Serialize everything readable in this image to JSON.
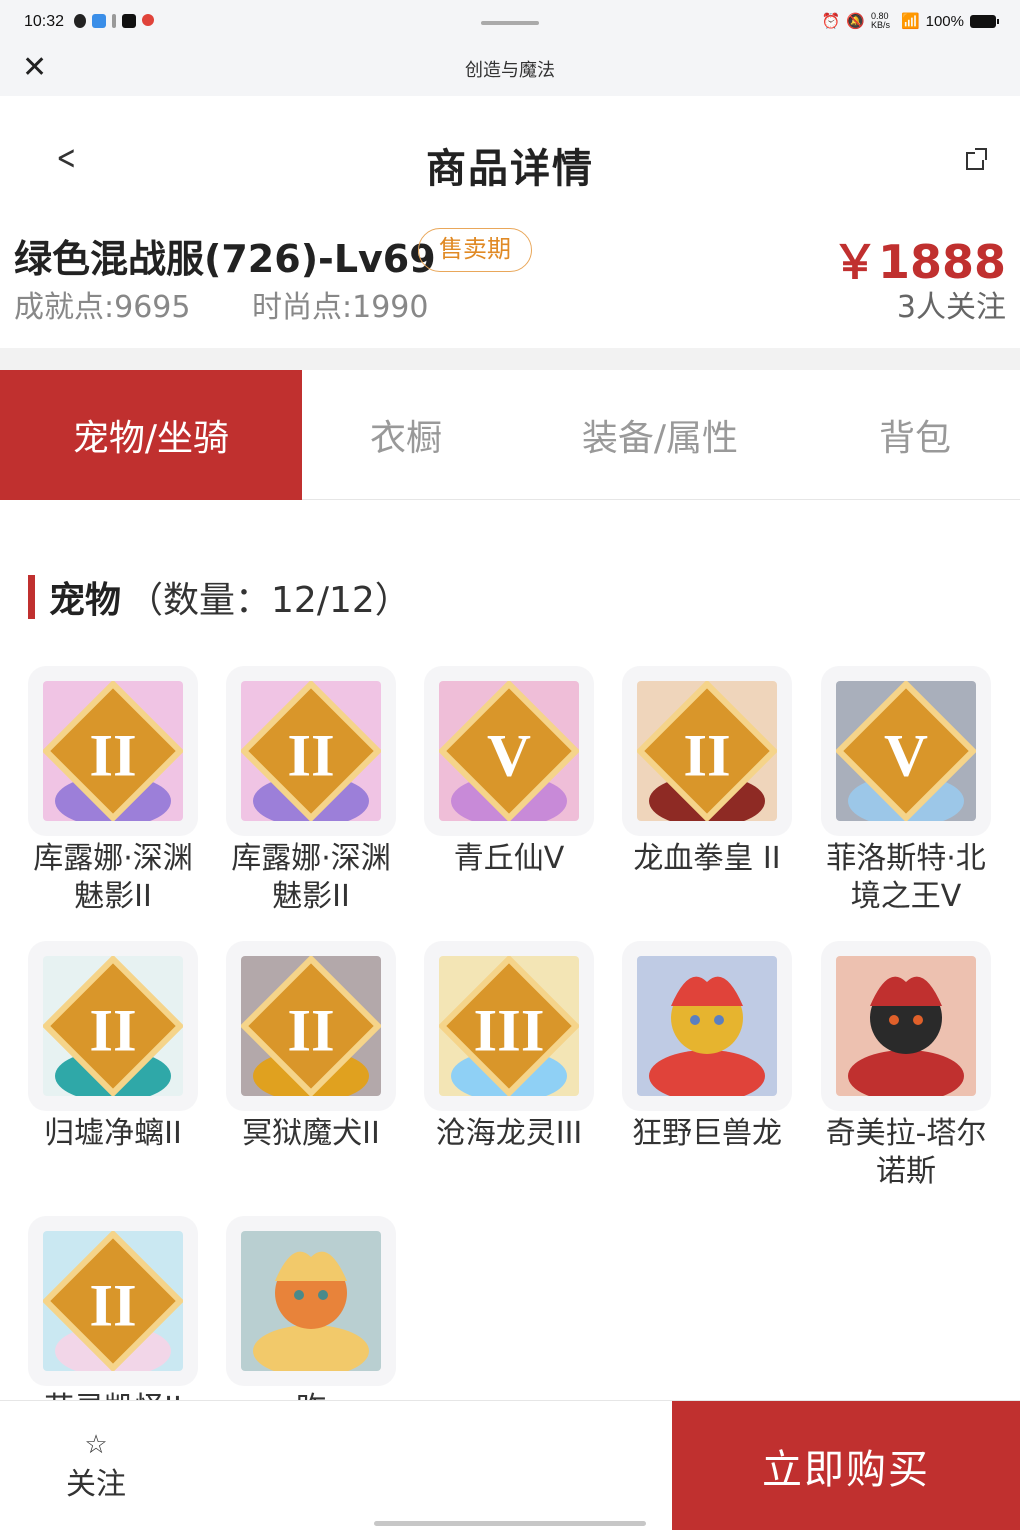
{
  "status": {
    "time": "10:32",
    "net_speed": "0.80 KB/s",
    "battery": "100%"
  },
  "appbar": {
    "title": "创造与魔法",
    "close_icon": "close-icon"
  },
  "nav": {
    "title": "商品详情",
    "back_icon": "chevron-left-icon",
    "share_icon": "share-icon"
  },
  "product": {
    "name": "绿色混战服(726)-Lv69",
    "badge": "售卖期",
    "achievement": "成就点:9695",
    "fashion": "时尚点:1990",
    "price": "￥1888",
    "followers": "3人关注"
  },
  "tabs": [
    {
      "label": "宠物/坐骑",
      "active": true
    },
    {
      "label": "衣橱",
      "active": false
    },
    {
      "label": "装备/属性",
      "active": false
    },
    {
      "label": "背包",
      "active": false
    }
  ],
  "section": {
    "title": "宠物",
    "count": "（数量：12/12）"
  },
  "pets": [
    {
      "name": "库露娜·深渊魅影II",
      "rank": "II",
      "colors": [
        "#d7d9f5",
        "#9c7fd9",
        "#e86ac0"
      ]
    },
    {
      "name": "库露娜·深渊魅影II",
      "rank": "II",
      "colors": [
        "#d7d9f5",
        "#9c7fd9",
        "#e86ac0"
      ]
    },
    {
      "name": "青丘仙V",
      "rank": "V",
      "colors": [
        "#f2c6e6",
        "#c88ad8",
        "#e55a9e"
      ]
    },
    {
      "name": "龙血拳皇 II",
      "rank": "II",
      "colors": [
        "#c6443a",
        "#8e2a24",
        "#e59a4a"
      ]
    },
    {
      "name": "菲洛斯特·北境之王V",
      "rank": "V",
      "colors": [
        "#2a6aa8",
        "#9cc7e8",
        "#1c2f4a"
      ]
    },
    {
      "name": "归墟净螭II",
      "rank": "II",
      "colors": [
        "#6fd6d2",
        "#2fa8a8",
        "#cdeee8"
      ]
    },
    {
      "name": "冥狱魔犬II",
      "rank": "II",
      "colors": [
        "#8a1f1f",
        "#e0a11f",
        "#3a1a1a"
      ]
    },
    {
      "name": "沧海龙灵III",
      "rank": "III",
      "colors": [
        "#3a8ee8",
        "#8fd0f5",
        "#f2c93a"
      ]
    },
    {
      "name": "狂野巨兽龙",
      "rank": "",
      "colors": [
        "#e6b42f",
        "#e0433a",
        "#5b7fc0"
      ]
    },
    {
      "name": "奇美拉-塔尔诺斯",
      "rank": "",
      "colors": [
        "#2a2a2a",
        "#c0302f",
        "#e0602a"
      ]
    },
    {
      "name": "花灵凯怪II",
      "rank": "II",
      "colors": [
        "#b77ae0",
        "#f2d6e8",
        "#7ad0e8"
      ]
    },
    {
      "name": "昨",
      "rank": "",
      "colors": [
        "#e8833a",
        "#f2c96a",
        "#4a8a8a"
      ]
    }
  ],
  "bottom": {
    "follow_label": "关注",
    "star_icon": "star-outline-icon",
    "buy_label": "立即购买"
  }
}
